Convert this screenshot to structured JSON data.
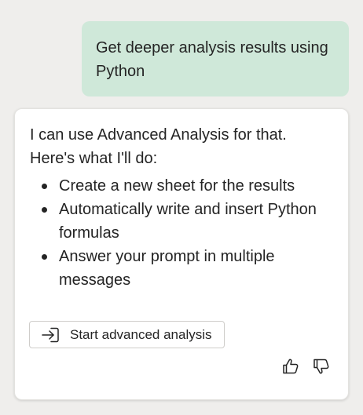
{
  "user_message": {
    "lines": [
      "Get deeper analysis results using",
      "Python"
    ]
  },
  "reply": {
    "intro_lines": [
      "I can use Advanced Analysis for that.",
      "Here's what I'll do:"
    ],
    "steps": [
      {
        "lines": [
          "Create a new sheet for the results"
        ]
      },
      {
        "lines": [
          "Automatically write and insert Python",
          "formulas"
        ]
      },
      {
        "lines": [
          "Answer your prompt in multiple",
          "messages"
        ]
      }
    ],
    "action_button": {
      "label": "Start advanced analysis",
      "icon": "arrow-into-box-icon"
    },
    "feedback": {
      "thumbs_up_icon": "thumbs-up-icon",
      "thumbs_down_icon": "thumbs-down-icon"
    }
  },
  "colors": {
    "background": "#efeeec",
    "user_bubble": "#cfe8d9",
    "card": "#ffffff",
    "text": "#242424"
  }
}
